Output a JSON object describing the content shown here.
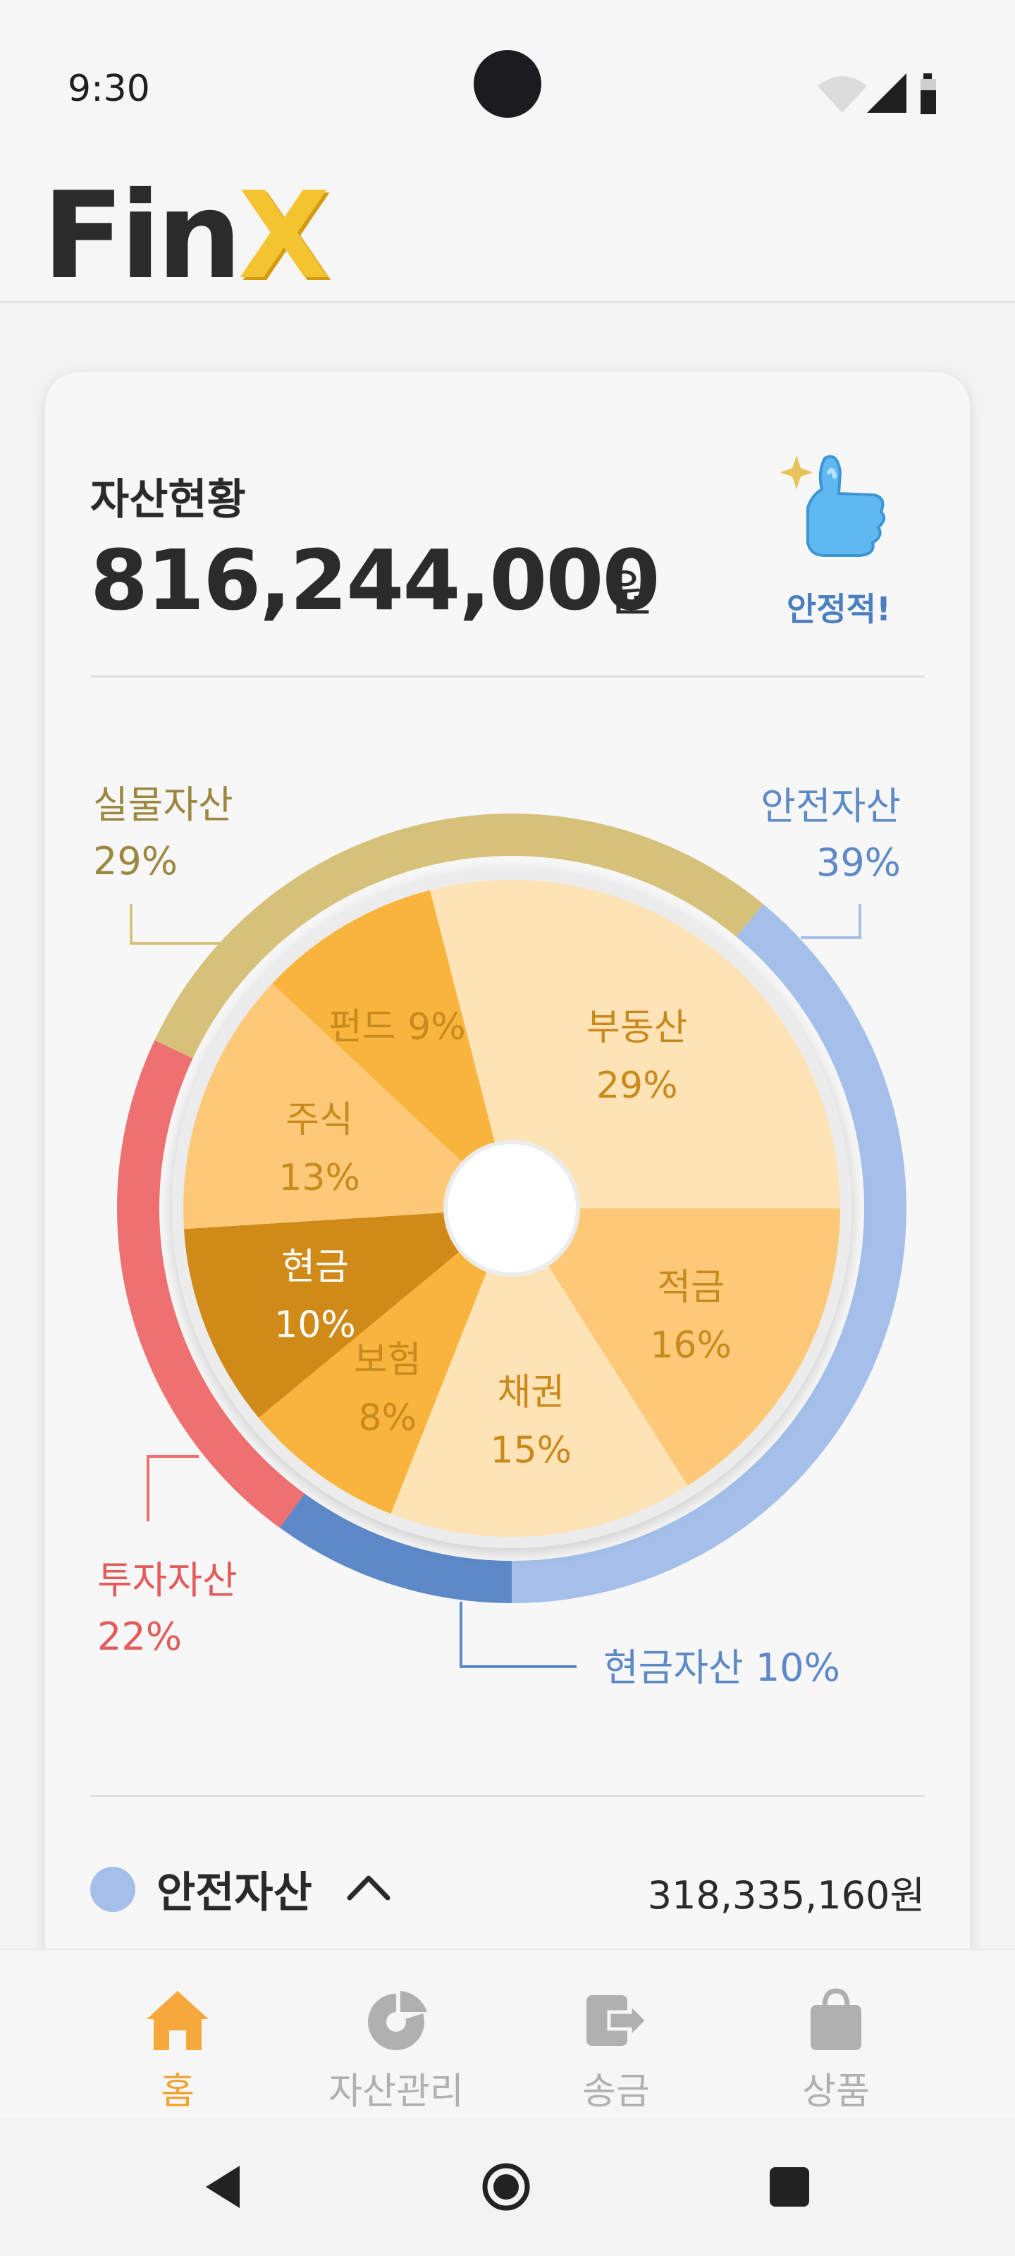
{
  "status_bar": {
    "time": "9:30"
  },
  "brand": {
    "logo_main": "Fin",
    "logo_accent": "X"
  },
  "summary": {
    "title": "자산현황",
    "total_amount": "816,244,000",
    "unit": "원",
    "status_label": "안정적!",
    "status_icon": "thumbs-up-icon"
  },
  "chart_data": {
    "type": "pie",
    "inner_slices": [
      {
        "label": "적금",
        "value": 16,
        "display": "16%",
        "color": "#fdc978",
        "category": "안전자산"
      },
      {
        "label": "채권",
        "value": 15,
        "display": "15%",
        "color": "#fee3b6",
        "category": "안전자산"
      },
      {
        "label": "보험",
        "value": 8,
        "display": "8%",
        "color": "#f8b43c",
        "category": "안전자산"
      },
      {
        "label": "현금",
        "value": 10,
        "display": "10%",
        "color": "#d08a17",
        "category": "현금자산"
      },
      {
        "label": "주식",
        "value": 13,
        "display": "13%",
        "color": "#fdc978",
        "category": "투자자산"
      },
      {
        "label": "펀드",
        "value": 9,
        "display": "9%",
        "color": "#f8b43c",
        "category": "투자자산"
      },
      {
        "label": "부동산",
        "value": 29,
        "display": "29%",
        "color": "#fee3b6",
        "category": "실물자산"
      }
    ],
    "outer_ring": [
      {
        "label": "안전자산",
        "value": 39,
        "display": "39%",
        "color": "#a3bfea"
      },
      {
        "label": "현금자산",
        "value": 10,
        "display": "10%",
        "color": "#5d89c8"
      },
      {
        "label": "투자자산",
        "value": 22,
        "display": "22%",
        "color": "#ef7070"
      },
      {
        "label": "실물자산",
        "value": 29,
        "display": "29%",
        "color": "#d6c17a"
      }
    ]
  },
  "category_row": {
    "name": "안전자산",
    "amount": "318,335,160원",
    "dot_color": "#a3bfea"
  },
  "bottom_nav": [
    {
      "label": "홈",
      "icon": "home-icon",
      "active": true
    },
    {
      "label": "자산관리",
      "icon": "pie-chart-icon",
      "active": false
    },
    {
      "label": "송금",
      "icon": "transfer-icon",
      "active": false
    },
    {
      "label": "상품",
      "icon": "shopping-bag-icon",
      "active": false
    }
  ]
}
